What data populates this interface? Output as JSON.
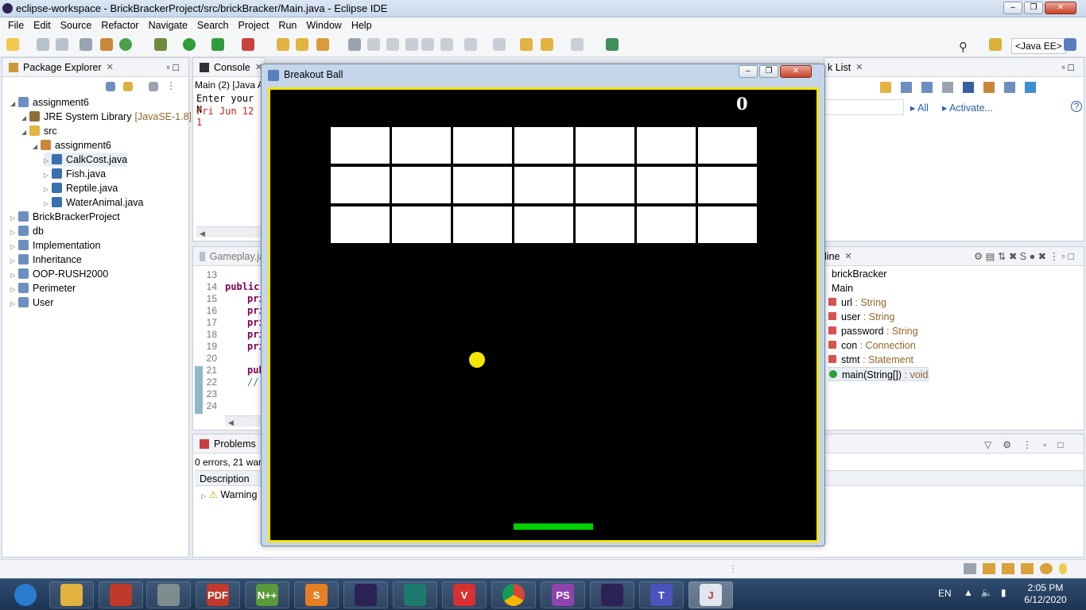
{
  "window": {
    "title": "eclipse-workspace - BrickBrackerProject/src/brickBracker/Main.java - Eclipse IDE"
  },
  "menu": [
    "File",
    "Edit",
    "Source",
    "Refactor",
    "Navigate",
    "Search",
    "Project",
    "Run",
    "Window",
    "Help"
  ],
  "perspective": "<Java EE>",
  "package_explorer": {
    "tab_label": "Package Explorer",
    "tree": [
      {
        "label": "assignment6",
        "level": 0,
        "icon": "project-icon"
      },
      {
        "label": "JRE System Library",
        "suffix": "[JavaSE-1.8]",
        "level": 1,
        "icon": "library-icon"
      },
      {
        "label": "src",
        "level": 1,
        "icon": "source-folder-icon"
      },
      {
        "label": "assignment6",
        "level": 2,
        "icon": "package-icon"
      },
      {
        "label": "CalkCost.java",
        "level": 3,
        "icon": "java-file-icon"
      },
      {
        "label": "Fish.java",
        "level": 3,
        "icon": "java-file-icon"
      },
      {
        "label": "Reptile.java",
        "level": 3,
        "icon": "java-file-icon"
      },
      {
        "label": "WaterAnimal.java",
        "level": 3,
        "icon": "java-file-icon"
      },
      {
        "label": "BrickBrackerProject",
        "level": 0,
        "icon": "project-icon"
      },
      {
        "label": "db",
        "level": 0,
        "icon": "project-icon"
      },
      {
        "label": "Implementation",
        "level": 0,
        "icon": "project-icon"
      },
      {
        "label": "Inheritance",
        "level": 0,
        "icon": "project-icon"
      },
      {
        "label": "OOP-RUSH2000",
        "level": 0,
        "icon": "folder-icon"
      },
      {
        "label": "Perimeter",
        "level": 0,
        "icon": "folder-icon"
      },
      {
        "label": "User",
        "level": 0,
        "icon": "project-icon"
      }
    ]
  },
  "console": {
    "tab_label": "Console",
    "header": "Main (2) [Java A",
    "line1": "Enter your N",
    "line2": "Fri Jun 12 1"
  },
  "editor": {
    "tab_label": "Gameplay.ja",
    "lines": [
      {
        "num": "13",
        "code": "",
        "kw": ""
      },
      {
        "num": "14",
        "code": "",
        "kw": "public"
      },
      {
        "num": "15",
        "code": "",
        "kw": "pri"
      },
      {
        "num": "16",
        "code": "",
        "kw": "pri"
      },
      {
        "num": "17",
        "code": "",
        "kw": "pri"
      },
      {
        "num": "18",
        "code": "",
        "kw": "pri"
      },
      {
        "num": "19",
        "code": "",
        "kw": "pri"
      },
      {
        "num": "20",
        "code": "",
        "kw": ""
      },
      {
        "num": "21",
        "code": "",
        "kw": "publ"
      },
      {
        "num": "22",
        "code": "//",
        "kw": ""
      },
      {
        "num": "23",
        "code": "",
        "kw": ""
      },
      {
        "num": "24",
        "code": "",
        "kw": ""
      }
    ]
  },
  "problems": {
    "tab_label": "Problems",
    "summary": "0 errors, 21 warn",
    "column": "Description",
    "row": "Warning"
  },
  "task_list": {
    "tab_label": "k List",
    "filter_all": "All",
    "activate": "Activate..."
  },
  "outline": {
    "tab_label": "line",
    "items": [
      {
        "label": "brickBracker",
        "type": ""
      },
      {
        "label": "Main",
        "type": ""
      },
      {
        "label": "url",
        "type": " : String"
      },
      {
        "label": "user",
        "type": " : String"
      },
      {
        "label": "password",
        "type": " : String"
      },
      {
        "label": "con",
        "type": " : Connection"
      },
      {
        "label": "stmt",
        "type": " : Statement"
      },
      {
        "label": "main(String[])",
        "type": " : void"
      }
    ]
  },
  "breakout": {
    "title": "Breakout Ball",
    "score": "0",
    "bricks": {
      "rows": 3,
      "cols": 7
    },
    "colors": {
      "background": "#000000",
      "border": "#f5e600",
      "brick": "#ffffff",
      "ball": "#f5e600",
      "paddle": "#00d100"
    }
  },
  "taskbar": {
    "language": "EN",
    "time": "2:05 PM",
    "date": "6/12/2020",
    "apps": [
      "windows-start-icon",
      "file-explorer-icon",
      "ccleaner-icon",
      "snipping-tool-icon",
      "pdf-reader-icon",
      "notepad-plus-plus-icon",
      "sublime-text-icon",
      "eclipse-icon",
      "vs-code-icon",
      "vivaldi-icon",
      "chrome-icon",
      "phpstorm-icon",
      "eclipse-ide-icon",
      "teams-icon",
      "java-icon"
    ]
  }
}
